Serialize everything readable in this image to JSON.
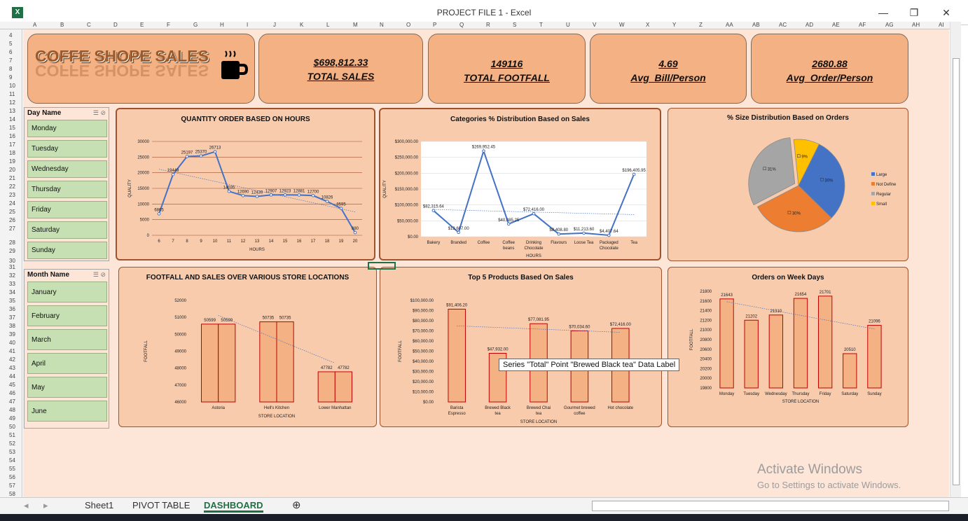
{
  "window": {
    "title": "PROJECT FILE 1 - Excel",
    "logo": "X",
    "min": "—",
    "max": "❐",
    "close": "✕"
  },
  "columns": [
    "A",
    "B",
    "C",
    "D",
    "E",
    "F",
    "G",
    "H",
    "I",
    "J",
    "K",
    "L",
    "M",
    "N",
    "O",
    "P",
    "Q",
    "R",
    "S",
    "T",
    "U",
    "V",
    "W",
    "X",
    "Y",
    "Z",
    "AA",
    "AB",
    "AC",
    "AD",
    "AE",
    "AF",
    "AG",
    "AH",
    "AI"
  ],
  "rows": [
    "4",
    "5",
    "6",
    "7",
    "8",
    "9",
    "10",
    "11",
    "12",
    "13",
    "14",
    "15",
    "16",
    "17",
    "18",
    "19",
    "20",
    "21",
    "22",
    "23",
    "24",
    "25",
    "26",
    "27",
    "28",
    "29",
    "30",
    "31",
    "32",
    "33",
    "34",
    "35",
    "36",
    "37",
    "38",
    "39",
    "40",
    "41",
    "42",
    "43",
    "44",
    "45",
    "46",
    "47",
    "48",
    "49",
    "50",
    "51",
    "52",
    "53",
    "54",
    "55",
    "56",
    "57",
    "58"
  ],
  "header": {
    "logo_text": "COFFE SHOPE SALES",
    "total_sales_value": "$698,812.33",
    "total_sales_label": "TOTAL SALES",
    "footfall_value": "149116",
    "footfall_label": "TOTAL FOOTFALL",
    "avg_bill_value": "4.69",
    "avg_bill_label": "Avg_Bill/Person",
    "avg_order_value": "2680.88",
    "avg_order_label": "Avg_Order/Person"
  },
  "day_slicer": {
    "title": "Day Name",
    "items": [
      "Monday",
      "Tuesday",
      "Wednesday",
      "Thursday",
      "Friday",
      "Saturday",
      "Sunday"
    ]
  },
  "month_slicer": {
    "title": "Month Name",
    "items": [
      "January",
      "February",
      "March",
      "April",
      "May",
      "June"
    ]
  },
  "tooltip": "Series \"Total\" Point \"Brewed Black tea\" Data Label",
  "watermark": {
    "line1": "Activate Windows",
    "line2": "Go to Settings to activate Windows."
  },
  "tabs": [
    "Sheet1",
    "PIVOT TABLE",
    "DASHBOARD"
  ],
  "colors": {
    "line": "#4472c4",
    "bar": "#f4b183",
    "bar_border": "#c00000",
    "grid": "#a0522d"
  },
  "chart_data": [
    {
      "type": "line",
      "title": "QUANTITY ORDER BASED ON HOURS",
      "xlabel": "HOURS",
      "ylabel": "QUALITY",
      "categories": [
        "6",
        "7",
        "8",
        "9",
        "10",
        "11",
        "12",
        "13",
        "14",
        "15",
        "16",
        "17",
        "18",
        "19",
        "20"
      ],
      "values": [
        6865,
        19449,
        25197,
        25370,
        26713,
        14035,
        12690,
        12439,
        12907,
        12923,
        12881,
        12700,
        10826,
        8595,
        880
      ],
      "labels": [
        "6865",
        "19449",
        "25197",
        "25370",
        "26713",
        "14035",
        "12690",
        "12439",
        "12907",
        "12923",
        "12881",
        "12700",
        "10826",
        "8595",
        "880"
      ],
      "ylim": [
        0,
        30000
      ],
      "yticks": [
        "0",
        "5000",
        "10000",
        "15000",
        "20000",
        "25000",
        "30000"
      ],
      "trendline": true
    },
    {
      "type": "line",
      "title": "Categories % Distribution Based on Sales",
      "xlabel": "HOURS",
      "ylabel": "QUALITY",
      "categories": [
        "Bakery",
        "Branded",
        "Coffee",
        "Coffee beans",
        "Drinking Chocolate",
        "Flavours",
        "Loose Tea",
        "Packaged Chocolate",
        "Tea"
      ],
      "values": [
        82315.64,
        13607,
        269952.45,
        40085.25,
        72416,
        8408.8,
        11213.6,
        4407.64,
        196405.95
      ],
      "labels": [
        "$82,315.64",
        "$13,607.00",
        "$269,952.45",
        "$40,085.25",
        "$72,416.00",
        "$8,408.80",
        "$11,213.60",
        "$4,407.64",
        "$196,405.95"
      ],
      "ylim": [
        0,
        300000
      ],
      "yticks": [
        "$0.00",
        "$50,000.00",
        "$100,000.00",
        "$150,000.00",
        "$200,000.00",
        "$250,000.00",
        "$300,000.00"
      ],
      "trendline": true
    },
    {
      "type": "pie",
      "title": "% Size Distribution Based on Orders",
      "categories": [
        "Large",
        "Not Define",
        "Regular",
        "Small"
      ],
      "values": [
        30,
        30,
        31,
        9
      ],
      "labels": [
        "30%",
        "30%",
        "31%",
        "9%"
      ],
      "colors": [
        "#4472c4",
        "#ed7d31",
        "#a5a5a5",
        "#ffc000"
      ],
      "legend": "right"
    },
    {
      "type": "bar",
      "title": "FOOTFALL AND SALES OVER VARIOUS STORE LOCATIONS",
      "xlabel": "STORE LOCATION",
      "ylabel": "FOOTFALL",
      "categories": [
        "Astoria",
        "Hell's Kitchen",
        "Lower Manhattan"
      ],
      "series": [
        {
          "values": [
            50599,
            50735,
            47782
          ]
        },
        {
          "values": [
            50599,
            50735,
            47782
          ]
        }
      ],
      "labels": [
        "50599",
        "50735",
        "47782"
      ],
      "ylim": [
        46000,
        52000
      ],
      "yticks": [
        "46000",
        "47000",
        "48000",
        "49000",
        "50000",
        "51000",
        "52000"
      ],
      "trendline": true
    },
    {
      "type": "bar",
      "title": "Top 5 Products Based On Sales",
      "xlabel": "STORE LOCATION",
      "ylabel": "FOOTFALL",
      "categories": [
        "Barista Espresso",
        "Brewed Black tea",
        "Brewed Chai tea",
        "Gourmet brewed coffee",
        "Hot chocolate"
      ],
      "values": [
        91406.2,
        47932,
        77081.95,
        70034.6,
        72416
      ],
      "labels": [
        "$91,406.20",
        "$47,932.00",
        "$77,081.95",
        "$70,034.60",
        "$72,416.00"
      ],
      "ylim": [
        0,
        100000
      ],
      "yticks": [
        "$0.00",
        "$10,000.00",
        "$20,000.00",
        "$30,000.00",
        "$40,000.00",
        "$50,000.00",
        "$60,000.00",
        "$70,000.00",
        "$80,000.00",
        "$90,000.00",
        "$100,000.00"
      ],
      "trendline": true
    },
    {
      "type": "bar",
      "title": "Orders on Week Days",
      "xlabel": "STORE LOCATION",
      "ylabel": "FOOTFALL",
      "categories": [
        "Monday",
        "Tuesday",
        "Wednesday",
        "Thursday",
        "Friday",
        "Saturday",
        "Sunday"
      ],
      "values": [
        21643,
        21202,
        21310,
        21654,
        21701,
        20510,
        21096
      ],
      "labels": [
        "21643",
        "21202",
        "21310",
        "21654",
        "21701",
        "20510",
        "21096"
      ],
      "ylim": [
        19800,
        21800
      ],
      "yticks": [
        "19800",
        "20000",
        "20200",
        "20400",
        "20600",
        "20800",
        "21000",
        "21200",
        "21400",
        "21600",
        "21800"
      ],
      "trendline": true
    }
  ]
}
